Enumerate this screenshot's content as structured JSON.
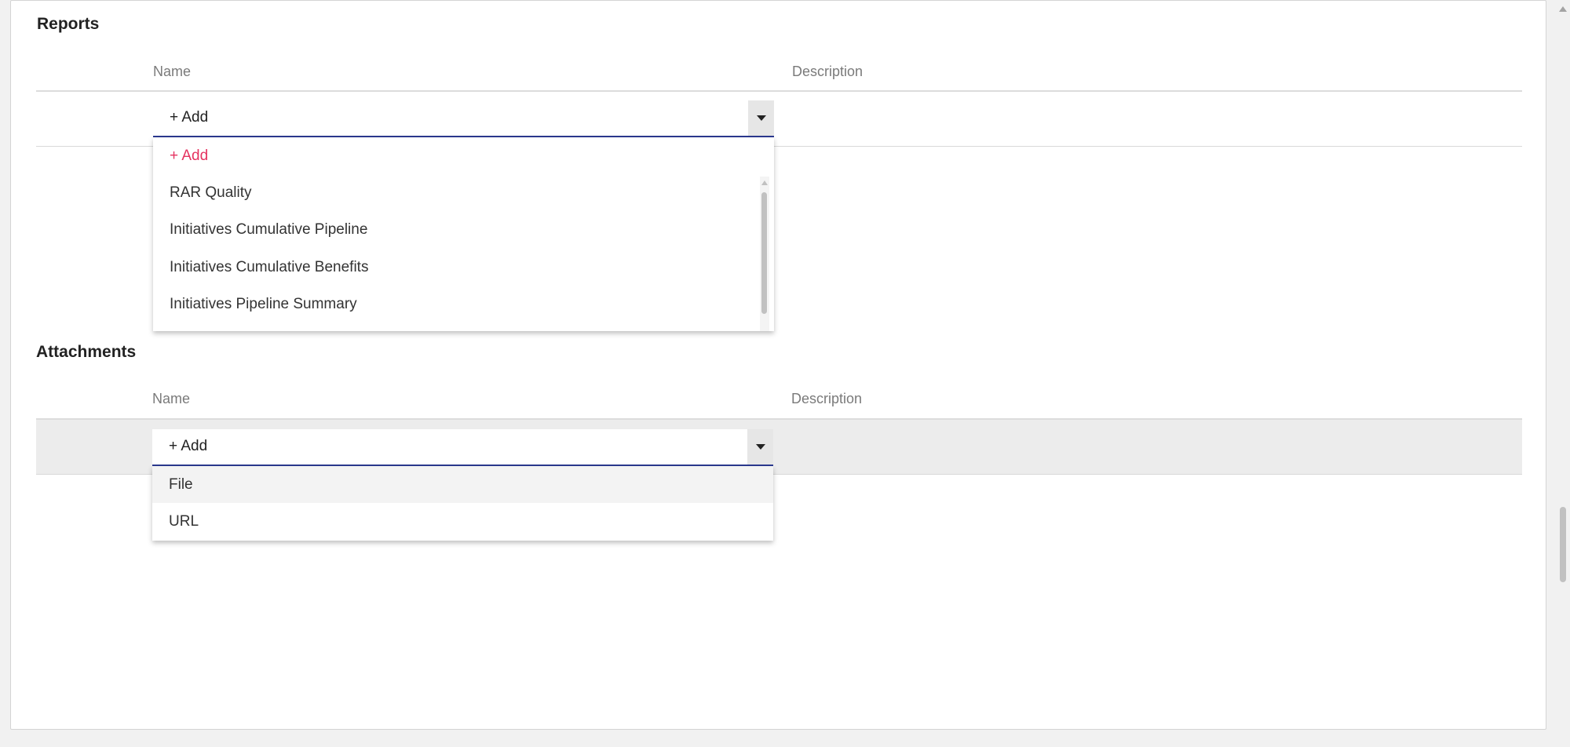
{
  "reports": {
    "title": "Reports",
    "columns": {
      "name": "Name",
      "description": "Description"
    },
    "select_value": "+ Add",
    "options": [
      {
        "label": "+ Add"
      },
      {
        "label": "RAR Quality"
      },
      {
        "label": "Initiatives Cumulative Pipeline"
      },
      {
        "label": "Initiatives Cumulative Benefits"
      },
      {
        "label": "Initiatives Pipeline Summary"
      }
    ]
  },
  "attachments": {
    "title": "Attachments",
    "columns": {
      "name": "Name",
      "description": "Description"
    },
    "select_value": "+ Add",
    "options": [
      {
        "label": "File"
      },
      {
        "label": "URL"
      }
    ]
  },
  "colors": {
    "accent": "#e53360",
    "select_underline": "#2b3990",
    "row_highlight": "#ececec"
  }
}
